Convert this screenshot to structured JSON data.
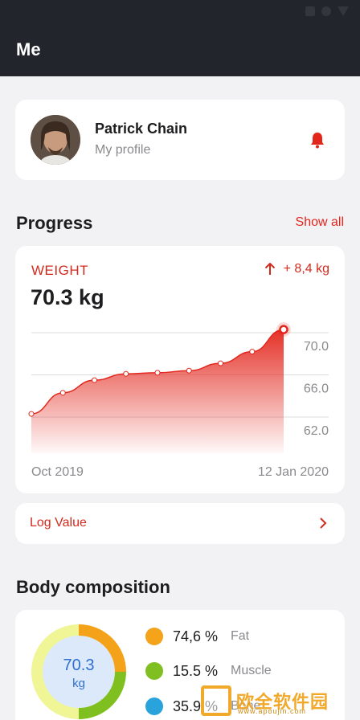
{
  "app_bar": {
    "title": "Me"
  },
  "profile": {
    "name": "Patrick Chain",
    "subtitle": "My profile"
  },
  "progress": {
    "title": "Progress",
    "show_all": "Show all"
  },
  "weight": {
    "label": "WEIGHT",
    "value": "70.3 kg",
    "delta": "+ 8,4 kg",
    "accent": "#e3261c"
  },
  "chart_data": {
    "type": "area",
    "x": [
      "Oct 2019",
      "",
      "",
      "",
      "",
      "",
      "",
      "",
      "12 Jan 2020"
    ],
    "values": [
      62.3,
      64.3,
      65.5,
      66.1,
      66.2,
      66.4,
      67.1,
      68.2,
      70.3
    ],
    "y_ticks": [
      "70.0",
      "66.0",
      "62.0"
    ],
    "x_tick_labels": [
      "Oct 2019",
      "12 Jan 2020"
    ],
    "ylim": [
      62.0,
      70.0
    ],
    "grid": true,
    "color": "#e3261c"
  },
  "log": {
    "label": "Log Value"
  },
  "body": {
    "title": "Body composition",
    "center_value": "70.3",
    "center_unit": "kg",
    "items": [
      {
        "value": "74,6 %",
        "name": "Fat",
        "color": "#f3a21a"
      },
      {
        "value": "15.5 %",
        "name": "Muscle",
        "color": "#7fbf1f"
      },
      {
        "value": "35.9 %",
        "name": "Bone",
        "color": "#2aa3dc"
      }
    ]
  },
  "watermark": {
    "text": "欧全软件园",
    "sub": "www.apoujin.com"
  }
}
